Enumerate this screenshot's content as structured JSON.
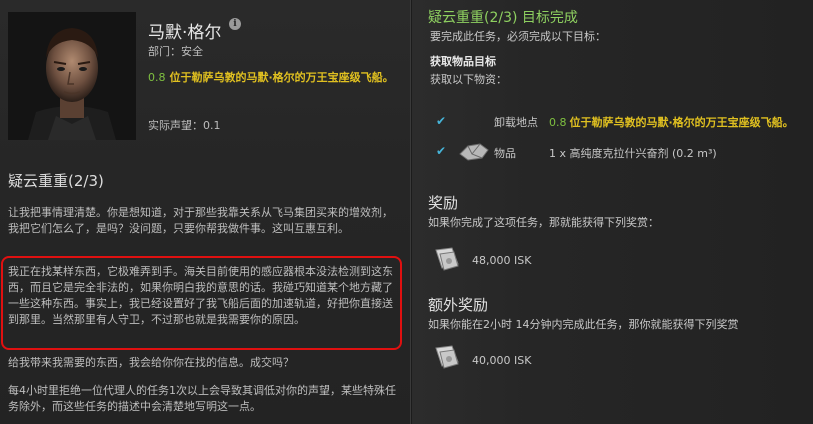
{
  "agent": {
    "name": "马默·格尔",
    "department": "部门：安全",
    "location_security": "0.8",
    "location_text": "位于勒萨乌敦的马默·格尔的万王宝座级飞船。",
    "standing": "实际声望：0.1"
  },
  "mission": {
    "title": "疑云重重(2/3)",
    "paragraphs": [
      "让我把事情理清楚。你是想知道，对于那些我靠关系从飞马集团买来的增效剂，我把它们怎么了，是吗？没问题，只要你帮我做件事。这叫互惠互利。",
      "我正在找某样东西，它极难弄到手。海关目前使用的感应器根本没法检测到这东西，而且它是完全非法的，如果你明白我的意思的话。我碰巧知道某个地方藏了一些这种东西。事实上，我已经设置好了我飞船后面的加速轨道，好把你直接送到那里。当然那里有人守卫，不过那也就是我需要你的原因。",
      "给我带来我需要的东西，我会给你你在找的信息。成交吗？",
      "每4小时里拒绝一位代理人的任务1次以上会导致其调低对你的声望，某些特殊任务除外，而这些任务的描述中会清楚地写明这一点。"
    ]
  },
  "objectives": {
    "title": "疑云重重(2/3) 目标完成",
    "subtitle": "要完成此任务，必须完成以下目标：",
    "section_title": "获取物品目标",
    "section_sub": "获取以下物资：",
    "dropoff_label": "卸载地点",
    "dropoff_security": "0.8",
    "dropoff_text": "位于勒萨乌敦的马默·格尔的万王宝座级飞船。",
    "item_label": "物品",
    "item_value": "1 x 高纯度克拉什兴奋剂 (0.2 m³)"
  },
  "rewards": {
    "title": "奖励",
    "desc": "如果你完成了这项任务，那就能获得下列奖赏：",
    "amount": "48,000 ISK"
  },
  "bonus": {
    "title": "额外奖励",
    "desc": "如果你能在2小时 14分钟内完成此任务，那你就能获得下列奖赏",
    "amount": "40,000 ISK"
  },
  "colors": {
    "objective_title": "#8ed060",
    "security": "#7fc040",
    "location": "#e0c020",
    "check": "#46b4d8",
    "highlight_border": "#e01010"
  },
  "icons": {
    "info": "info-icon",
    "check": "checkmark-icon",
    "item": "ship-cargo-icon",
    "isk": "isk-bills-icon"
  }
}
